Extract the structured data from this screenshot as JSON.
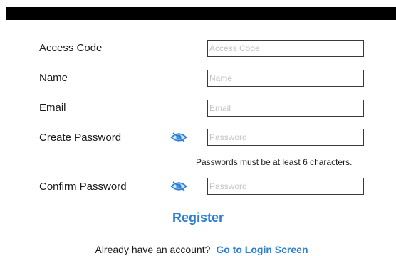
{
  "form": {
    "access_code": {
      "label": "Access Code",
      "placeholder": "Access Code",
      "value": ""
    },
    "name": {
      "label": "Name",
      "placeholder": "Name",
      "value": ""
    },
    "email": {
      "label": "Email",
      "placeholder": "Email",
      "value": ""
    },
    "create_password": {
      "label": "Create Password",
      "placeholder": "Password",
      "value": "",
      "toggle_icon": "eye-icon"
    },
    "password_hint": "Passwords must be at least 6 characters.",
    "confirm_password": {
      "label": "Confirm Password",
      "placeholder": "Password",
      "value": "",
      "toggle_icon": "eye-icon"
    }
  },
  "register_label": "Register",
  "footer": {
    "prompt": "Already have an account?",
    "link": "Go to Login Screen"
  },
  "colors": {
    "accent": "#2a7fd0",
    "top_bar": "#000000",
    "placeholder": "#c4c4c4"
  }
}
